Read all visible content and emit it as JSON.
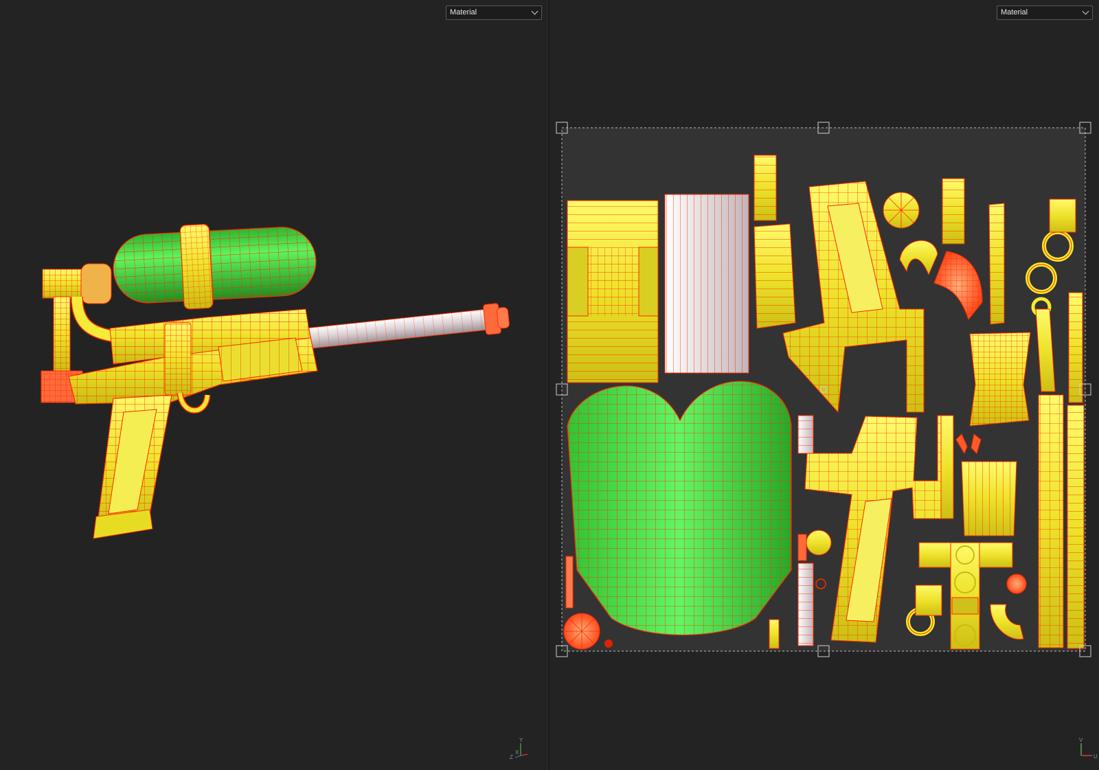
{
  "left_viewport": {
    "shading_mode": "Material",
    "axis_labels": {
      "y": "Y",
      "z": "Z",
      "x": "X"
    }
  },
  "right_viewport": {
    "shading_mode": "Material",
    "axis_labels": {
      "v": "V",
      "u": "U"
    }
  },
  "colors": {
    "background": "#232323",
    "uv_tile": "#333333",
    "wire": "#ff2a00",
    "yellow": "#f4ec2c",
    "green": "#3cd83c",
    "chrome": "#e8e0e2"
  }
}
